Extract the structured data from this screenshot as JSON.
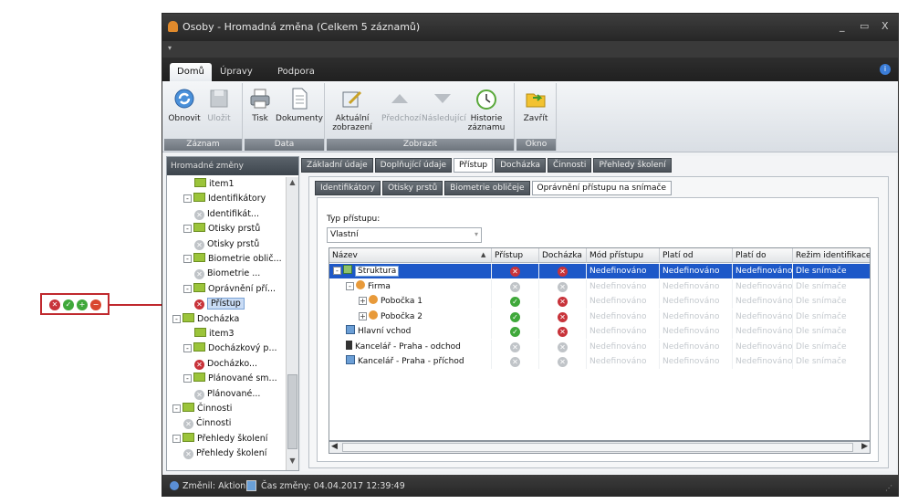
{
  "window": {
    "title": "Osoby - Hromadná změna (Celkem 5 záznamů)",
    "controls": [
      "_",
      "▭",
      "X"
    ]
  },
  "ribbon_tabs": [
    "Domů",
    "Úpravy",
    "Podpora"
  ],
  "ribbon": {
    "groups": [
      {
        "label": "Záznam",
        "buttons": [
          {
            "label": "Obnovit",
            "icon": "refresh-icon",
            "enabled": true
          },
          {
            "label": "Uložit",
            "icon": "save-icon",
            "enabled": false
          }
        ]
      },
      {
        "label": "Data",
        "buttons": [
          {
            "label": "Tisk",
            "icon": "printer-icon",
            "enabled": true
          },
          {
            "label": "Dokumenty",
            "icon": "document-icon",
            "enabled": true
          }
        ]
      },
      {
        "label": "Zobrazit",
        "buttons": [
          {
            "label": "Aktuální zobrazení",
            "icon": "edit-view-icon",
            "enabled": true
          },
          {
            "label": "Předchozí",
            "icon": "up-arrow-icon",
            "enabled": false
          },
          {
            "label": "Následující",
            "icon": "down-arrow-icon",
            "enabled": false
          },
          {
            "label": "Historie záznamu",
            "icon": "history-icon",
            "enabled": true
          }
        ]
      },
      {
        "label": "Okno",
        "buttons": [
          {
            "label": "Zavřít",
            "icon": "close-folder-icon",
            "enabled": true
          }
        ]
      }
    ]
  },
  "left_panel": {
    "title": "Hromadné změny",
    "tree": [
      {
        "label": "item1",
        "indent": 2,
        "icon": "folder"
      },
      {
        "label": "Identifikátory",
        "indent": 1,
        "icon": "folder",
        "expand": "-"
      },
      {
        "label": "Identifikát...",
        "indent": 2,
        "icon": "grey"
      },
      {
        "label": "Otisky prstů",
        "indent": 1,
        "icon": "folder",
        "expand": "-"
      },
      {
        "label": "Otisky prstů",
        "indent": 2,
        "icon": "grey"
      },
      {
        "label": "Biometrie oblič...",
        "indent": 1,
        "icon": "folder",
        "expand": "-"
      },
      {
        "label": "Biometrie ...",
        "indent": 2,
        "icon": "grey"
      },
      {
        "label": "Oprávnění pří...",
        "indent": 1,
        "icon": "folder",
        "expand": "-"
      },
      {
        "label": "Přístup",
        "indent": 2,
        "icon": "red",
        "selected": true
      },
      {
        "label": "Docházka",
        "indent": 0,
        "icon": "folder",
        "expand": "-"
      },
      {
        "label": "item3",
        "indent": 2,
        "icon": "folder"
      },
      {
        "label": "Docházkový p...",
        "indent": 1,
        "icon": "folder",
        "expand": "-"
      },
      {
        "label": "Docházko...",
        "indent": 2,
        "icon": "red"
      },
      {
        "label": "Plánované sm...",
        "indent": 1,
        "icon": "folder",
        "expand": "-"
      },
      {
        "label": "Plánované...",
        "indent": 2,
        "icon": "grey"
      },
      {
        "label": "Činnosti",
        "indent": 0,
        "icon": "folder",
        "expand": "-"
      },
      {
        "label": "Činnosti",
        "indent": 1,
        "icon": "grey"
      },
      {
        "label": "Přehledy školení",
        "indent": 0,
        "icon": "folder",
        "expand": "-"
      },
      {
        "label": "Přehledy školení",
        "indent": 1,
        "icon": "grey"
      }
    ]
  },
  "main_tabs": [
    "Základní údaje",
    "Doplňující údaje",
    "Přístup",
    "Docházka",
    "Činnosti",
    "Přehledy školení"
  ],
  "main_tab_active": 2,
  "sub_tabs": [
    "Identifikátory",
    "Otisky prstů",
    "Biometrie obličeje",
    "Oprávnění přístupu na snímače"
  ],
  "sub_tab_active": 3,
  "access_type": {
    "label": "Typ přístupu:",
    "value": "Vlastní"
  },
  "grid": {
    "columns": [
      "Název",
      "Přístup",
      "Docházka",
      "Mód přístupu",
      "Platí od",
      "Platí do",
      "Režim identifikace"
    ],
    "rows": [
      {
        "name": "Struktura",
        "level": 0,
        "icon": "structure",
        "expand": "-",
        "pristup": "red",
        "dochazka": "red",
        "mod": "Nedefinováno",
        "od": "Nedefinováno",
        "do": "Nedefinováno",
        "rezim": "Dle snímače",
        "selected": true
      },
      {
        "name": "Firma",
        "level": 1,
        "icon": "company",
        "expand": "-",
        "pristup": "grey",
        "dochazka": "grey",
        "mod": "Nedefinováno",
        "od": "Nedefinováno",
        "do": "Nedefinováno",
        "rezim": "Dle snímače"
      },
      {
        "name": "Pobočka 1",
        "level": 2,
        "icon": "company",
        "expand": "+",
        "pristup": "green",
        "dochazka": "red",
        "mod": "Nedefinováno",
        "od": "Nedefinováno",
        "do": "Nedefinováno",
        "rezim": "Dle snímače"
      },
      {
        "name": "Pobočka 2",
        "level": 2,
        "icon": "company",
        "expand": "+",
        "pristup": "green",
        "dochazka": "red",
        "mod": "Nedefinováno",
        "od": "Nedefinováno",
        "do": "Nedefinováno",
        "rezim": "Dle snímače"
      },
      {
        "name": "Hlavní vchod",
        "level": 1,
        "icon": "reader",
        "pristup": "green",
        "dochazka": "red",
        "mod": "Nedefinováno",
        "od": "Nedefinováno",
        "do": "Nedefinováno",
        "rezim": "Dle snímače"
      },
      {
        "name": "Kancelář - Praha - odchod",
        "level": 1,
        "icon": "phone",
        "pristup": "grey",
        "dochazka": "grey",
        "mod": "Nedefinováno",
        "od": "Nedefinováno",
        "do": "Nedefinováno",
        "rezim": "Dle snímače"
      },
      {
        "name": "Kancelář - Praha - příchod",
        "level": 1,
        "icon": "reader",
        "pristup": "grey",
        "dochazka": "grey",
        "mod": "Nedefinováno",
        "od": "Nedefinováno",
        "do": "Nedefinováno",
        "rezim": "Dle snímače"
      }
    ]
  },
  "status": {
    "changed_by": "Změnil: Aktion",
    "changed_at": "Čas změny: 04.04.2017 12:39:49"
  },
  "legend_icons": [
    "red",
    "green",
    "green-plus",
    "red-minus"
  ],
  "colors": {
    "selection": "#1d58c8",
    "callout": "#c0292e",
    "folder": "#9bc43a"
  }
}
